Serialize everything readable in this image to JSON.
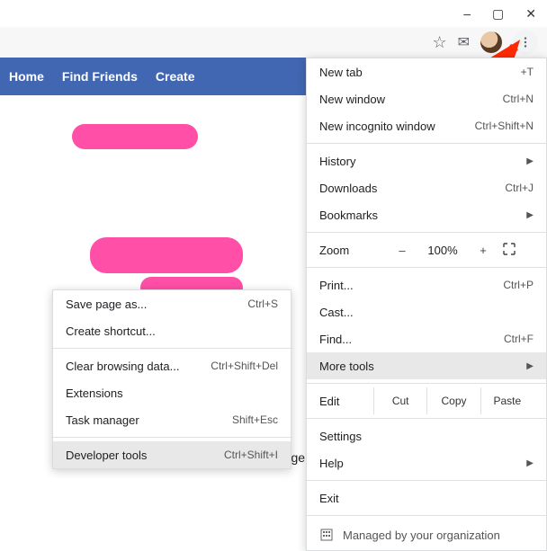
{
  "window": {
    "min": "–",
    "max": "▢",
    "close": "✕"
  },
  "toolbar": {
    "star": "☆",
    "mail": "✉"
  },
  "fb": {
    "home": "Home",
    "find_friends": "Find Friends",
    "create": "Create"
  },
  "menu": {
    "new_tab": {
      "label": "New tab",
      "shortcut": "+T"
    },
    "new_window": {
      "label": "New window",
      "shortcut": "Ctrl+N"
    },
    "new_incognito": {
      "label": "New incognito window",
      "shortcut": "Ctrl+Shift+N"
    },
    "history": {
      "label": "History"
    },
    "downloads": {
      "label": "Downloads",
      "shortcut": "Ctrl+J"
    },
    "bookmarks": {
      "label": "Bookmarks"
    },
    "zoom": {
      "label": "Zoom",
      "minus": "–",
      "pct": "100%",
      "plus": "+"
    },
    "print": {
      "label": "Print...",
      "shortcut": "Ctrl+P"
    },
    "cast": {
      "label": "Cast..."
    },
    "find": {
      "label": "Find...",
      "shortcut": "Ctrl+F"
    },
    "more_tools": {
      "label": "More tools"
    },
    "edit": {
      "label": "Edit",
      "cut": "Cut",
      "copy": "Copy",
      "paste": "Paste"
    },
    "settings": {
      "label": "Settings"
    },
    "help": {
      "label": "Help"
    },
    "exit": {
      "label": "Exit"
    },
    "managed": {
      "label": "Managed by your organization"
    }
  },
  "submenu": {
    "save_page": {
      "label": "Save page as...",
      "shortcut": "Ctrl+S"
    },
    "create_shortcut": {
      "label": "Create shortcut..."
    },
    "clear_browsing": {
      "label": "Clear browsing data...",
      "shortcut": "Ctrl+Shift+Del"
    },
    "extensions": {
      "label": "Extensions"
    },
    "task_manager": {
      "label": "Task manager",
      "shortcut": "Shift+Esc"
    },
    "developer_tools": {
      "label": "Developer tools",
      "shortcut": "Ctrl+Shift+I"
    }
  },
  "footer": {
    "change_theme": "Change Theme"
  }
}
